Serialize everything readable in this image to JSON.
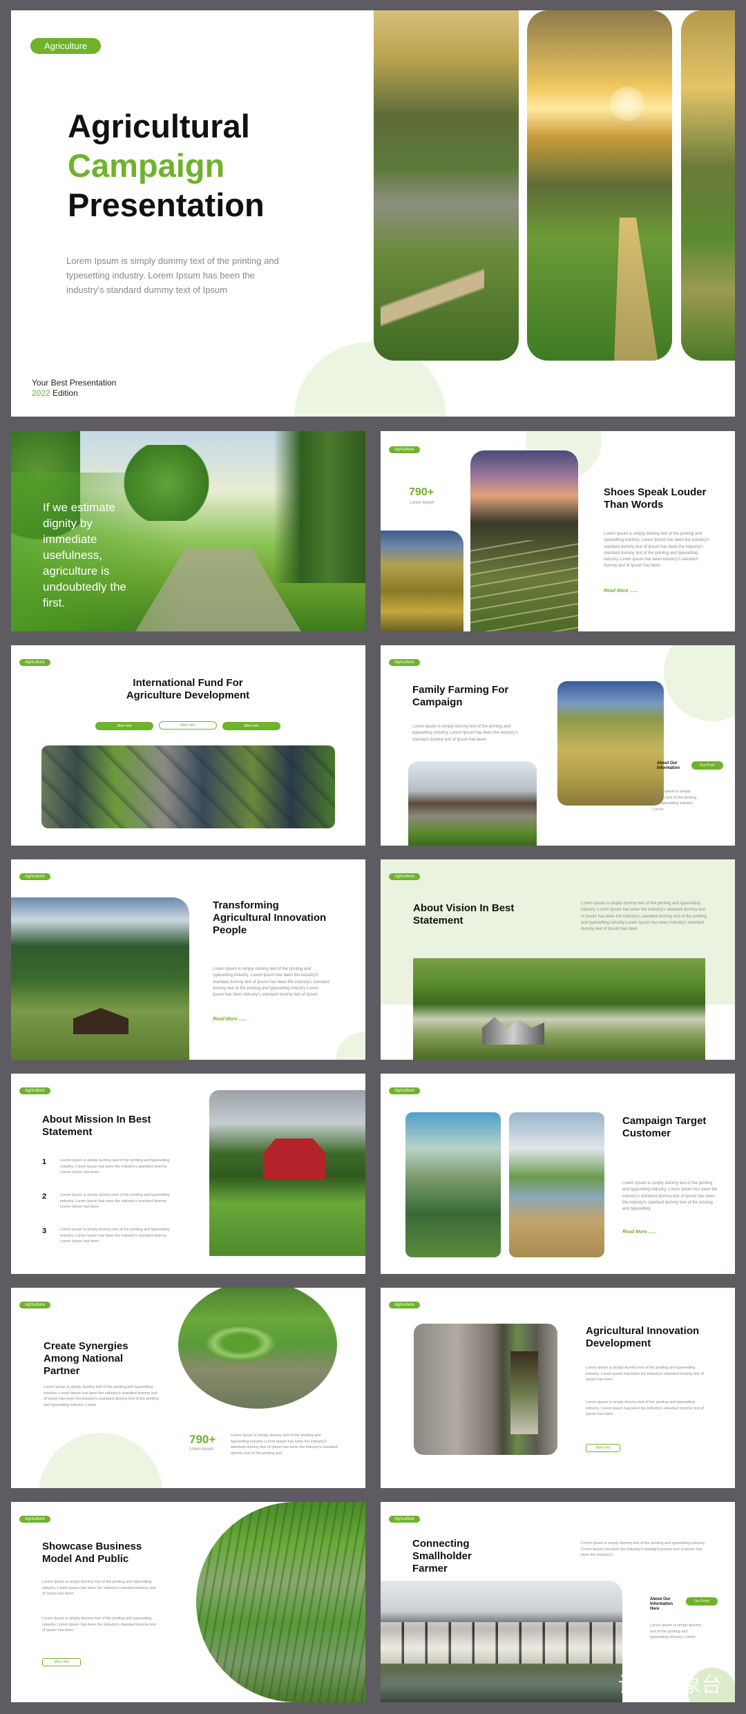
{
  "slide1": {
    "tag": "Agriculture",
    "title_line1": "Agricultural",
    "title_line2": "Campaign",
    "title_line3": "Presentation",
    "body": "Lorem Ipsum is simply dummy text of the printing and typesetting industry. Lorem Ipsum has been the industry's standard dummy text of Ipsum",
    "footer_line1": "Your Best Presentation",
    "footer_year": "2022",
    "footer_edition": "Edition"
  },
  "slide2": {
    "quote": "If we estimate dignity by immediate usefulness, agriculture is undoubtedly the first."
  },
  "slide3": {
    "tag": "Agriculture",
    "stat": "790+",
    "stat_label": "Lorem Ipsum",
    "title": "Shoes Speak Louder Than Words",
    "body": "Lorem Ipsum is simply dummy text of the printing and typesetting industry. Lorem Ipsum has been the industry's standard dummy text of Ipsum has been the industry's standard dummy text of the printing and typesetting industry Lorem Ipsum has been industry's standard dummy text of Ipsum has been",
    "read_more": "Read More ......"
  },
  "slide4": {
    "tag": "Agriculture",
    "title": "International Fund For Agriculture Development",
    "btn1": "More Info",
    "btn2": "More Info",
    "btn3": "More Info"
  },
  "slide5": {
    "tag": "Agriculture",
    "title": "Family Farming For Campaign",
    "body": "Lorem Ipsum is simply dummy text of the printing and typesetting industry. Lorem Ipsum has been the industry's standard dummy text of Ipsum has been",
    "side_title": "About Our Information",
    "side_btn": "Our Proof",
    "side_body": "Lorem Ipsum is simply dummy text of the printing and typesetting industry Lorem"
  },
  "slide6": {
    "tag": "Agriculture",
    "title": "Transforming Agricultural Innovation People",
    "body": "Lorem Ipsum is simply dummy text of the printing and typesetting industry. Lorem Ipsum has been the industry's standard dummy text of Ipsum has been the industry's standard dummy text of the printing and typesetting industry Lorem Ipsum has been industry's standard dummy text of Ipsum",
    "read_more": "Read More ......"
  },
  "slide7": {
    "tag": "Agriculture",
    "title": "About Vision In Best Statement",
    "body": "Lorem Ipsum is simply dummy text of the printing and typesetting industry. Lorem Ipsum has been the industry's standard dummy text of Ipsum has been the industry's standard dummy text of the printing and typesetting industry Lorem Ipsum has been industry's standard dummy text of Ipsum has been"
  },
  "slide8": {
    "tag": "Agriculture",
    "title": "About Mission In Best Statement",
    "items": [
      {
        "num": "1",
        "text": "Lorem Ipsum is simply dummy text of the printing and typesetting industry. Lorem Ipsum has been the industry's standard dummy Lorem Ipsum has been"
      },
      {
        "num": "2",
        "text": "Lorem Ipsum is simply dummy text of the printing and typesetting industry. Lorem Ipsum has been the industry's standard dummy Lorem Ipsum has been"
      },
      {
        "num": "3",
        "text": "Lorem Ipsum is simply dummy text of the printing and typesetting industry. Lorem Ipsum has been the industry's standard dummy Lorem Ipsum has been"
      }
    ]
  },
  "slide9": {
    "tag": "Agriculture",
    "title": "Campaign Target Customer",
    "body": "Lorem Ipsum is simply dummy text of the printing and typesetting industry. Lorem Ipsum has been the industry's standard dummy text of Ipsum has been the industry's standard dummy text of the printing and typesetting",
    "read_more": "Read More ......"
  },
  "slide10": {
    "tag": "Agriculture",
    "title": "Create Synergies Among National Partner",
    "body": "Lorem Ipsum is simply dummy text of the printing and typesetting industry. Lorem Ipsum has been the industry's standard dummy text of Ipsum has been the industry's standard dummy text of the printing and typesetting industry. Lorem",
    "stat": "790+",
    "stat_label": "Lorem Ipsum",
    "stat_body": "Lorem Ipsum is simply dummy text of the printing and typesetting industry Lorem Ipsum has been the industry's standard dummy text of Ipsum has been the industry's standard dummy text of the printing and"
  },
  "slide11": {
    "tag": "Agriculture",
    "title": "Agricultural Innovation Development",
    "body1": "Lorem Ipsum is simply dummy text of the printing and typesetting industry. Lorem Ipsum has been the industry's standard dummy text of Ipsum has been",
    "body2": "Lorem Ipsum is simply dummy text of the printing and typesetting industry. Lorem Ipsum has been the industry's standard dummy text of Ipsum has been",
    "btn": "More Info"
  },
  "slide12": {
    "tag": "Agriculture",
    "title": "Showcase Business Model And Public",
    "body1": "Lorem Ipsum is simply dummy text of the printing and typesetting industry. Lorem Ipsum has been the industry's standard dummy text of Ipsum has been",
    "body2": "Lorem Ipsum is simply dummy text of the printing and typesetting industry. Lorem Ipsum has been the industry's standard dummy text of Ipsum has been",
    "btn": "More Info"
  },
  "slide13": {
    "tag": "Agriculture",
    "title": "Connecting Smallholder Farmer",
    "body": "Lorem Ipsum is simply dummy text of the printing and typesetting industry. Lorem Ipsum has been the industry's standard dummy text of Ipsum has been the industry's",
    "side_title": "About Our Information Here",
    "side_btn": "Our Proof",
    "side_body": "Lorem Ipsum is simply dummy text of the printing and typesetting industry. Lorem"
  },
  "watermark": "设计气象台",
  "colors": {
    "accent": "#6fb22c",
    "background": "#5e5c61",
    "slide": "#ffffff",
    "soft_green": "#ecf5e1"
  }
}
